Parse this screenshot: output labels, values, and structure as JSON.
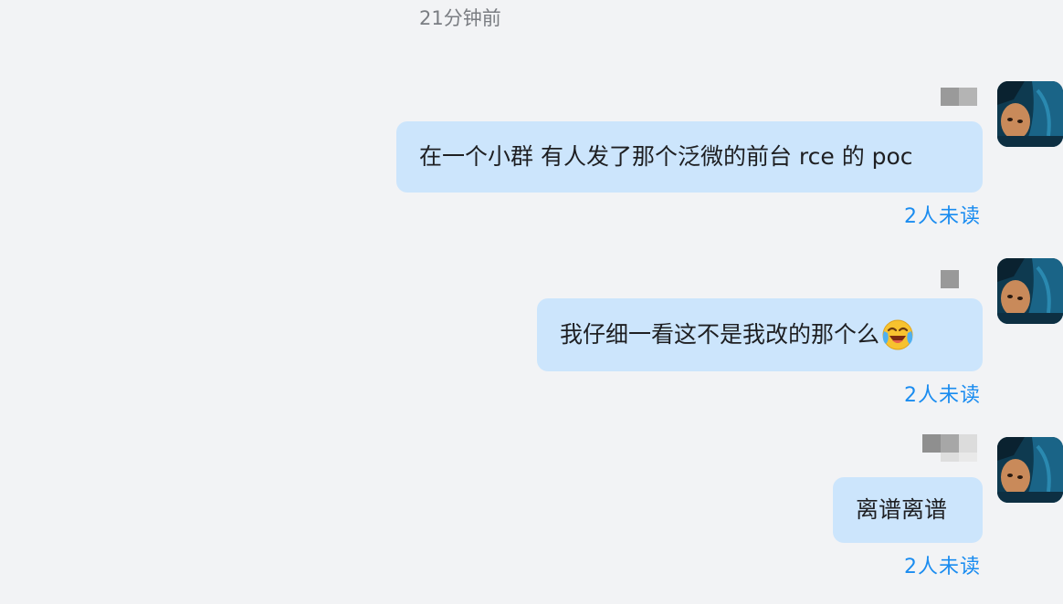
{
  "chat": {
    "timestamp": "21分钟前",
    "messages": [
      {
        "text": "在一个小群 有人发了那个泛微的前台 rce 的 poc",
        "read_status": "2人未读",
        "emoji": null
      },
      {
        "text": "我仔细一看这不是我改的那个么",
        "read_status": "2人未读",
        "emoji": "crying-laughing-emoji"
      },
      {
        "text": "离谱离谱",
        "read_status": "2人未读",
        "emoji": null
      }
    ]
  },
  "colors": {
    "background": "#f2f3f5",
    "bubble": "#cce5fc",
    "read_status": "#1a8cf0",
    "timestamp": "#7a7d82"
  }
}
